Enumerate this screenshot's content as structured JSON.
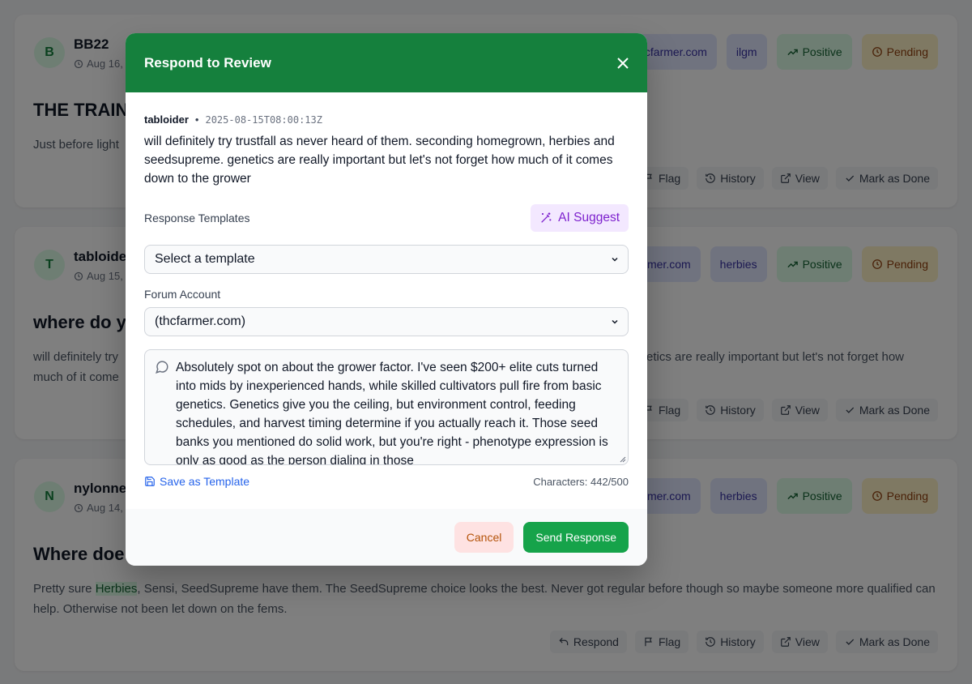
{
  "reviews": [
    {
      "avatar": "B",
      "author": "BB22",
      "date": "Aug 16,",
      "title": "THE TRAIN",
      "body": "Just before light",
      "badges": [
        "cfarmer.com",
        "ilgm",
        "Positive",
        "Pending"
      ]
    },
    {
      "avatar": "T",
      "author": "tabloide",
      "date": "Aug 15,",
      "title": "where do y",
      "body_left": "will definitely try",
      "body_left2": "much of it come",
      "body_right": "etics are really important but let's not forget how",
      "badges": [
        "rmer.com",
        "herbies",
        "Positive",
        "Pending"
      ]
    },
    {
      "avatar": "N",
      "author": "nylonne",
      "date": "Aug 14,",
      "title": "Where doe",
      "body_pre": "Pretty sure ",
      "body_hl": "Herbies",
      "body_post": ", Sensi, SeedSupreme have them. The SeedSupreme choice looks the best. Never got regular before though so maybe someone more qualified can help. Otherwise not been let down on the fems.",
      "badges": [
        "rmer.com",
        "herbies",
        "Positive",
        "Pending"
      ]
    }
  ],
  "actions": {
    "respond": "Respond",
    "flag": "Flag",
    "history": "History",
    "view": "View",
    "done": "Mark as Done"
  },
  "modal": {
    "title": "Respond to Review",
    "close": "×",
    "username": "tabloider",
    "timestamp": "2025-08-15T08:00:13Z",
    "original": "will definitely try trustfall as never heard of them. seconding homegrown, herbies and seedsupreme. genetics are really important but let's not forget how much of it comes down to the grower",
    "templates_label": "Response Templates",
    "ai_suggest": "AI Suggest",
    "template_select": "Select a template",
    "account_label": "Forum Account",
    "account_select": "(thcfarmer.com)",
    "response": "Absolutely spot on about the grower factor. I've seen $200+ elite cuts turned into mids by inexperienced hands, while skilled cultivators pull fire from basic genetics. Genetics give you the ceiling, but environment control, feeding schedules, and harvest timing determine if you actually reach it. Those seed banks you mentioned do solid work, but you're right - phenotype expression is only as good as the person dialing in those",
    "save_template": "Save as Template",
    "char_count": "Characters: 442/500",
    "cancel": "Cancel",
    "send": "Send Response"
  },
  "colors": {
    "header": "#15803d",
    "send": "#16a34a",
    "ai": "#7e22ce"
  }
}
